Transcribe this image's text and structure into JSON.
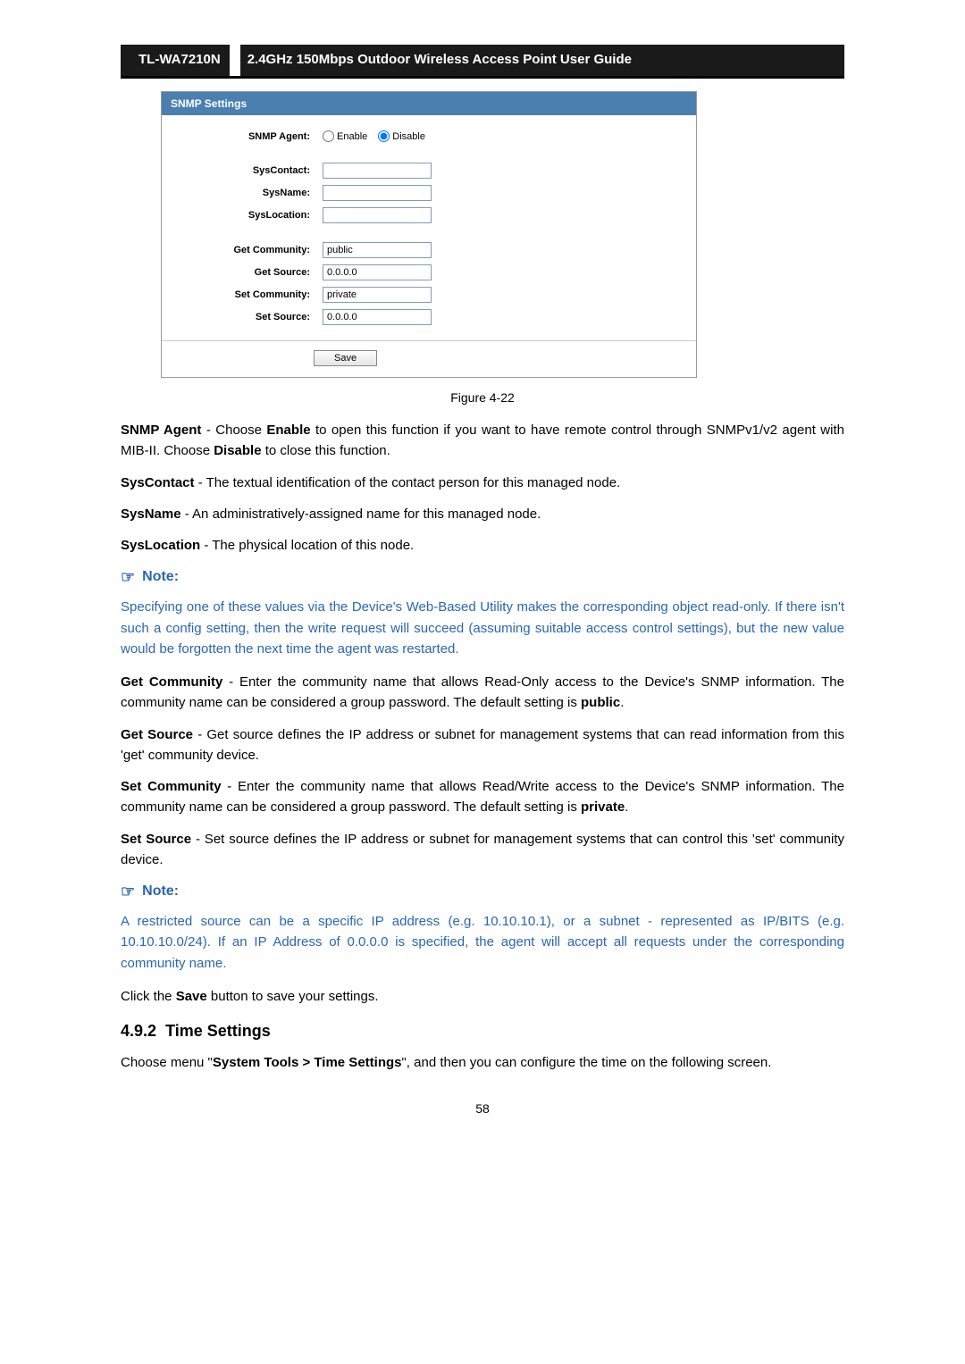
{
  "header": {
    "model": "TL-WA7210N",
    "title": "2.4GHz 150Mbps Outdoor Wireless Access Point User Guide"
  },
  "screenshot": {
    "title": "SNMP Settings",
    "labels": {
      "agent": "SNMP Agent:",
      "syscontact": "SysContact:",
      "sysname": "SysName:",
      "syslocation": "SysLocation:",
      "getcommunity": "Get Community:",
      "getsource": "Get Source:",
      "setcommunity": "Set Community:",
      "setsource": "Set Source:"
    },
    "radios": {
      "enable": "Enable",
      "disable": "Disable"
    },
    "values": {
      "syscontact": "",
      "sysname": "",
      "syslocation": "",
      "getcommunity": "public",
      "getsource": "0.0.0.0",
      "setcommunity": "private",
      "setsource": "0.0.0.0"
    },
    "save_label": "Save"
  },
  "figure_caption": "Figure 4-22",
  "paras": {
    "snmp_agent_label": "SNMP Agent",
    "snmp_agent_text1": " - Choose ",
    "snmp_agent_enable": "Enable",
    "snmp_agent_text2": " to open this function if you want to have remote control through SNMPv1/v2 agent with MIB-II. Choose ",
    "snmp_agent_disable": "Disable",
    "snmp_agent_text3": " to close this function.",
    "syscontact_label": "SysContact",
    "syscontact_text": " - The textual identification of the contact person for this managed node.",
    "sysname_label": "SysName",
    "sysname_text": " - An administratively-assigned name for this managed node.",
    "syslocation_label": "SysLocation",
    "syslocation_text": " - The physical location of this node.",
    "getcomm_label": "Get Community",
    "getcomm_text1": " - Enter the community name that allows Read-Only access to the Device's SNMP information. The community name can be considered a group password. The default setting is ",
    "getcomm_bold": "public",
    "getcomm_text2": ".",
    "getsource_label": "Get Source",
    "getsource_text": " - Get source defines the IP address or subnet for management systems that can read information from this 'get' community device.",
    "setcomm_label": "Set Community",
    "setcomm_text1": " - Enter the community name that allows Read/Write access to the Device's SNMP information. The community name can be considered a group password. The default setting is ",
    "setcomm_bold": "private",
    "setcomm_text2": ".",
    "setsource_label": "Set Source",
    "setsource_text": " - Set source defines the IP address or subnet for management systems that can control this 'set' community device.",
    "save_text1": "Click the ",
    "save_bold": "Save",
    "save_text2": " button to save your settings."
  },
  "notes": {
    "heading": "Note:",
    "body1": "Specifying one of these values via the Device's Web-Based Utility makes the corresponding object read-only. If there isn't such a config setting, then the write request will succeed (assuming suitable access control settings), but the new value would be forgotten the next time the agent was restarted.",
    "body2": "A restricted source can be a specific IP address (e.g. 10.10.10.1), or a subnet - represented as IP/BITS (e.g. 10.10.10.0/24). If an IP Address of 0.0.0.0 is specified, the agent will accept all requests under the corresponding community name."
  },
  "section": {
    "number": "4.9.2",
    "title": "Time Settings",
    "body1": "Choose menu \"",
    "body_bold": "System Tools > Time Settings",
    "body2": "\", and then you can configure the time on the following screen."
  },
  "page_number": "58"
}
